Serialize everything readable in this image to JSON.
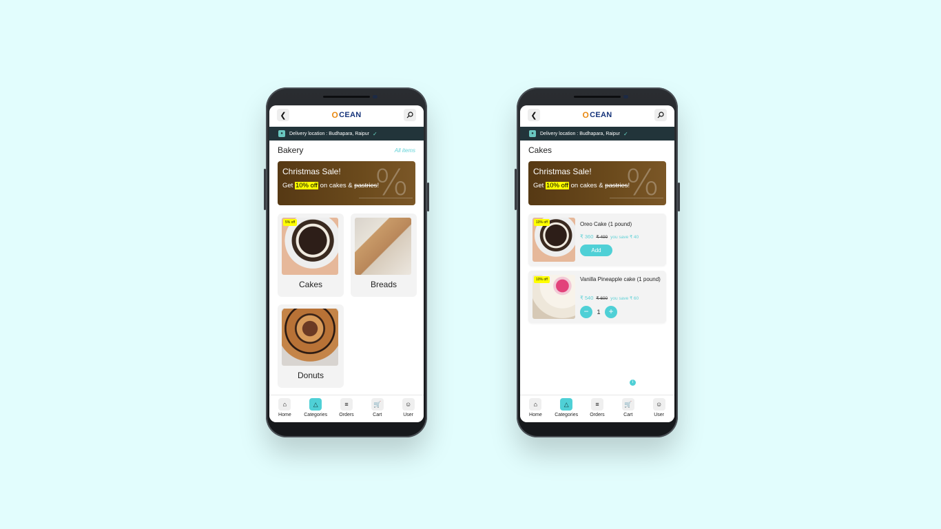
{
  "app": {
    "logo_o": "O",
    "logo_rest": "CEAN",
    "delivery": "Delivery location : Budhapara, Raipur"
  },
  "banner": {
    "title": "Christmas Sale!",
    "sub_prefix": "Get ",
    "highlight": "10% off",
    "sub_mid": " on cakes & ",
    "strike_word": "pastries",
    "sub_end": "!",
    "decor": "%"
  },
  "left_screen": {
    "section_title": "Bakery",
    "all_items": "All items",
    "categories": [
      {
        "label": "Cakes",
        "badge": "5% off"
      },
      {
        "label": "Breads",
        "badge": ""
      },
      {
        "label": "Donuts",
        "badge": ""
      }
    ]
  },
  "right_screen": {
    "section_title": "Cakes",
    "products": [
      {
        "badge": "10% off",
        "name": "Oreo Cake (1 pound)",
        "price": "₹ 360",
        "old_price": "₹ 400",
        "save": "you save ₹ 40",
        "add_label": "Add"
      },
      {
        "badge": "10% off",
        "name": "Vanilla Pineapple cake (1 pound)",
        "price": "₹ 540",
        "old_price": "₹ 600",
        "save": "you save ₹ 60",
        "qty_minus": "−",
        "qty": "1",
        "qty_plus": "+"
      }
    ],
    "info": "i"
  },
  "nav": {
    "items": [
      {
        "label": "Home",
        "icon": "home-icon"
      },
      {
        "label": "Categories",
        "icon": "categories-icon"
      },
      {
        "label": "Orders",
        "icon": "orders-icon"
      },
      {
        "label": "Cart",
        "icon": "cart-icon"
      },
      {
        "label": "User",
        "icon": "user-icon"
      }
    ]
  },
  "colors": {
    "background": "#e2fdfd",
    "accent": "#4fd0d6",
    "delivery_bar": "#22343a",
    "highlight": "#ffff00"
  }
}
